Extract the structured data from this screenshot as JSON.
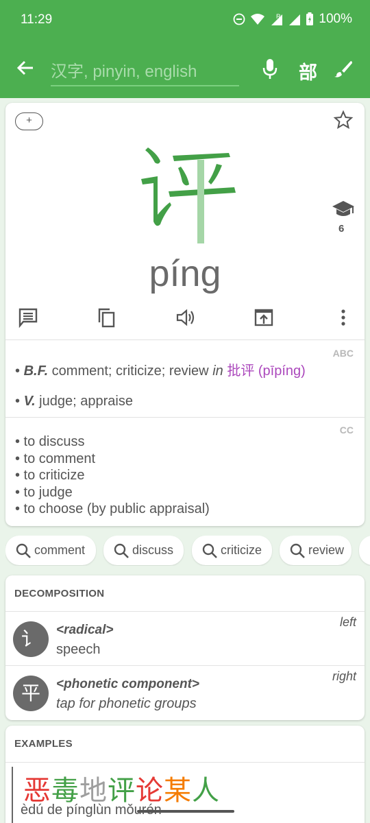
{
  "status_bar": {
    "time": "11:29",
    "battery": "100%",
    "icons": [
      "do-not-disturb-icon",
      "wifi-icon",
      "signal-roaming-icon",
      "signal-icon",
      "battery-icon"
    ]
  },
  "app_bar": {
    "search_placeholder": "汉字, pinyin, english",
    "radical_button": "部",
    "icons": [
      "back-arrow-icon",
      "mic-icon",
      "brush-icon"
    ],
    "color": "#4caf50"
  },
  "entry": {
    "add_label": "+",
    "character": "评",
    "pinyin": "píng",
    "hsk_level": "6",
    "colors": {
      "tone2": "#4caf50",
      "link": "#ab47bc"
    },
    "action_icons": [
      "comment-icon",
      "copy-icon",
      "volume-icon",
      "share-icon",
      "more-vert-icon"
    ]
  },
  "definitions": {
    "abc": {
      "tag": "ABC",
      "line1": {
        "bullet": "• ",
        "pos": "B.F.",
        "text": " comment; criticize; review ",
        "in": "in",
        "link": "批评 (pīpíng)"
      },
      "line2": {
        "bullet": "• ",
        "pos": "V.",
        "text": " judge; appraise"
      }
    },
    "cc": {
      "tag": "CC",
      "items": [
        "• to discuss",
        "• to comment",
        "• to criticize",
        "• to judge",
        "• to choose (by public appraisal)"
      ]
    }
  },
  "chips": [
    "comment",
    "discuss",
    "criticize",
    "review"
  ],
  "decomposition": {
    "title": "DECOMPOSITION",
    "components": [
      {
        "char": "讠",
        "title": "<radical>",
        "subtitle": "speech",
        "position": "left"
      },
      {
        "char": "平",
        "title": "<phonetic component>",
        "subtitle": "tap for phonetic groups",
        "position": "right"
      }
    ]
  },
  "examples": {
    "title": "EXAMPLES",
    "chars": [
      {
        "c": "恶",
        "color": "#e53935"
      },
      {
        "c": "毒",
        "color": "#43a047"
      },
      {
        "c": "地",
        "color": "#9e9e9e"
      },
      {
        "c": "评",
        "color": "#43a047"
      },
      {
        "c": "论",
        "color": "#e53935"
      },
      {
        "c": "某",
        "color": "#f57c00"
      },
      {
        "c": "人",
        "color": "#43a047"
      }
    ],
    "pinyin": "èdú de pínglùn mǒurén"
  }
}
